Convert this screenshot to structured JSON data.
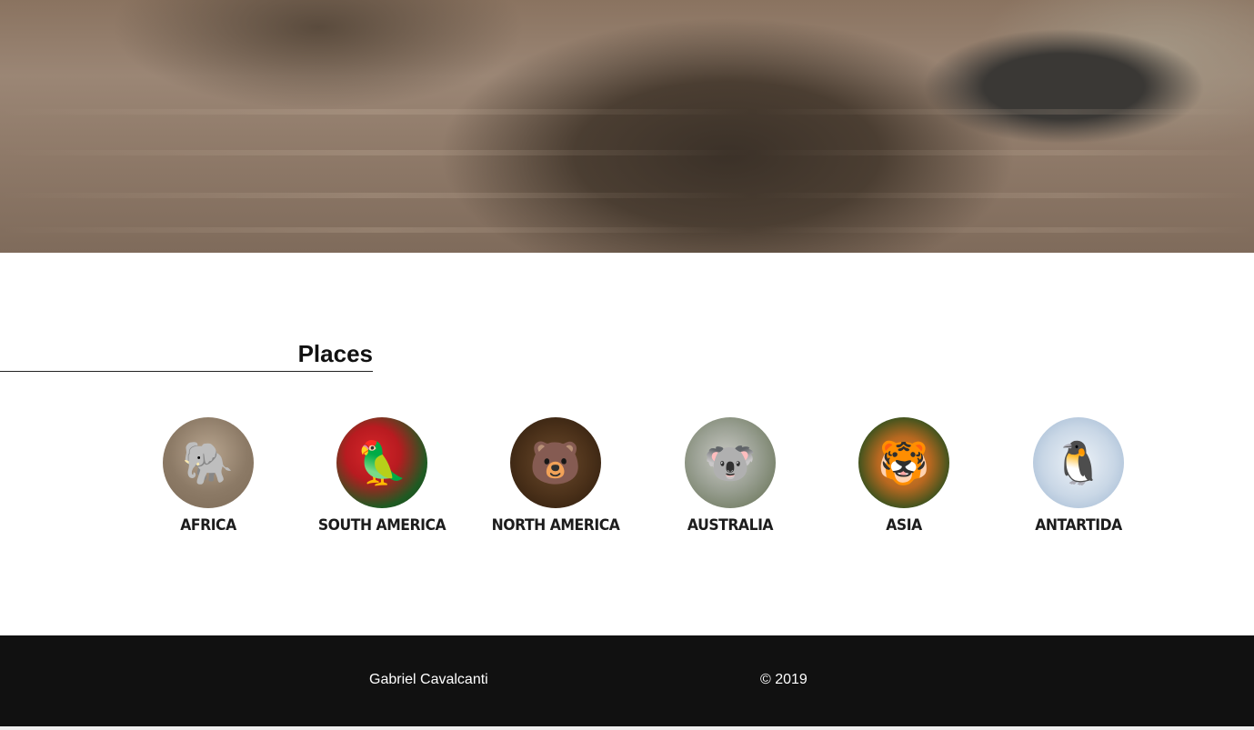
{
  "section": {
    "title": "Places"
  },
  "places": [
    {
      "label": "Africa",
      "icon": "elephant-icon",
      "glyph": "🐘"
    },
    {
      "label": "South America",
      "icon": "parrot-icon",
      "glyph": "🦜"
    },
    {
      "label": "North America",
      "icon": "bear-icon",
      "glyph": "🐻"
    },
    {
      "label": "Australia",
      "icon": "koala-icon",
      "glyph": "🐨"
    },
    {
      "label": "Asia",
      "icon": "tiger-icon",
      "glyph": "🐯"
    },
    {
      "label": "Antartida",
      "icon": "penguin-icon",
      "glyph": "🐧"
    }
  ],
  "footer": {
    "author": "Gabriel Cavalcanti",
    "copyright": "© 2019"
  },
  "colors": {
    "footer_bg": "#111111",
    "footer_text": "#ffffff",
    "text": "#1c1c1c"
  }
}
